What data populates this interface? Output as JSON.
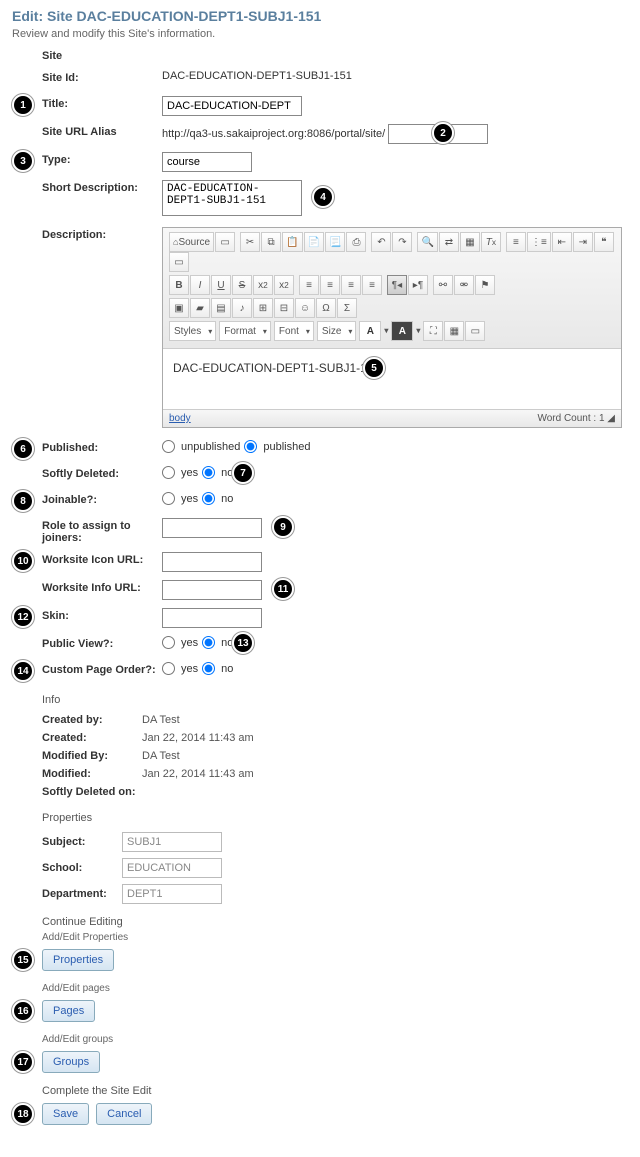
{
  "header": {
    "title": "Edit: Site DAC-EDUCATION-DEPT1-SUBJ1-151",
    "subtitle": "Review and modify this Site's information."
  },
  "section_site": "Site",
  "fields": {
    "site_id": {
      "label": "Site Id:",
      "value": "DAC-EDUCATION-DEPT1-SUBJ1-151"
    },
    "title": {
      "label": "Title:",
      "value": "DAC-EDUCATION-DEPT"
    },
    "url_alias": {
      "label": "Site URL Alias",
      "prefix": "http://qa3-us.sakaiproject.org:8086/portal/site/",
      "value": ""
    },
    "type": {
      "label": "Type:",
      "value": "course"
    },
    "short_desc": {
      "label": "Short Description:",
      "value": "DAC-EDUCATION-DEPT1-SUBJ1-151"
    },
    "description": {
      "label": "Description:"
    },
    "published": {
      "label": "Published:",
      "opt1": "unpublished",
      "opt2": "published"
    },
    "softly_deleted": {
      "label": "Softly Deleted:",
      "opt1": "yes",
      "opt2": "no"
    },
    "joinable": {
      "label": "Joinable?:",
      "opt1": "yes",
      "opt2": "no"
    },
    "role_joiners": {
      "label": "Role to assign to joiners:"
    },
    "icon_url": {
      "label": "Worksite Icon URL:"
    },
    "info_url": {
      "label": "Worksite Info URL:"
    },
    "skin": {
      "label": "Skin:"
    },
    "public_view": {
      "label": "Public View?:",
      "opt1": "yes",
      "opt2": "no"
    },
    "custom_order": {
      "label": "Custom Page Order?:",
      "opt1": "yes",
      "opt2": "no"
    }
  },
  "editor": {
    "source": "Source",
    "styles": "Styles",
    "format": "Format",
    "font": "Font",
    "size": "Size",
    "content": "DAC-EDUCATION-DEPT1-SUBJ1-151",
    "footer_path": "body",
    "footer_wc": "Word Count : 1"
  },
  "info": {
    "head": "Info",
    "created_by_l": "Created by:",
    "created_by_v": "DA Test",
    "created_l": "Created:",
    "created_v": "Jan 22, 2014 11:43 am",
    "modified_by_l": "Modified By:",
    "modified_by_v": "DA Test",
    "modified_l": "Modified:",
    "modified_v": "Jan 22, 2014 11:43 am",
    "sd_on_l": "Softly Deleted on:"
  },
  "props": {
    "head": "Properties",
    "subject_l": "Subject:",
    "subject_v": "SUBJ1",
    "school_l": "School:",
    "school_v": "EDUCATION",
    "dept_l": "Department:",
    "dept_v": "DEPT1"
  },
  "continue": {
    "head": "Continue Editing",
    "addedit_props": "Add/Edit Properties",
    "properties_btn": "Properties",
    "addedit_pages": "Add/Edit pages",
    "pages_btn": "Pages",
    "addedit_groups": "Add/Edit groups",
    "groups_btn": "Groups"
  },
  "complete": {
    "head": "Complete the Site Edit",
    "save": "Save",
    "cancel": "Cancel"
  },
  "badges": [
    "1",
    "2",
    "3",
    "4",
    "5",
    "6",
    "7",
    "8",
    "9",
    "10",
    "11",
    "12",
    "13",
    "14",
    "15",
    "16",
    "17",
    "18"
  ]
}
